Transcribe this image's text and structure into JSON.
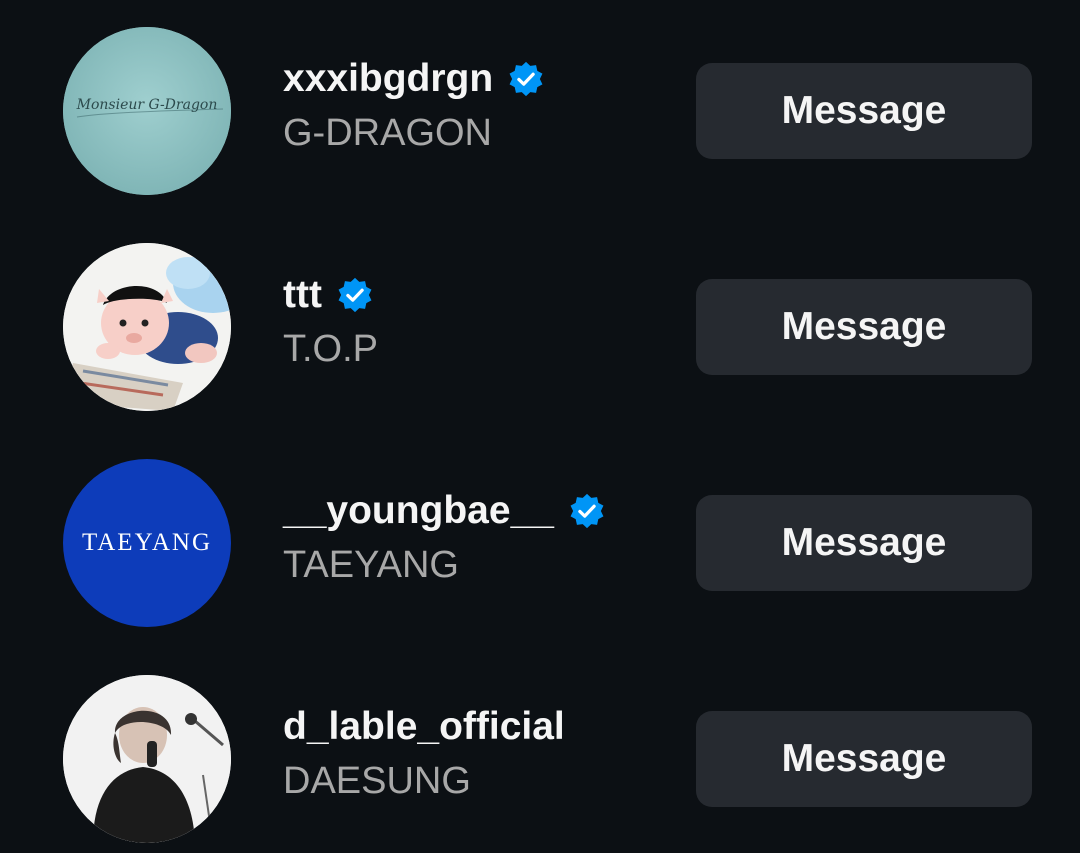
{
  "accounts": [
    {
      "username": "xxxibgdrgn",
      "full_name": "G-DRAGON",
      "verified": true,
      "avatar_text": "Monsieur G-Dragon",
      "button_label": "Message"
    },
    {
      "username": "ttt",
      "full_name": "T.O.P",
      "verified": true,
      "button_label": "Message"
    },
    {
      "username": "__youngbae__",
      "full_name": "TAEYANG",
      "verified": true,
      "avatar_text": "TAEYANG",
      "button_label": "Message"
    },
    {
      "username": "d_lable_official",
      "full_name": "DAESUNG",
      "verified": false,
      "button_label": "Message"
    }
  ],
  "colors": {
    "background": "#0c1014",
    "button": "#262a30",
    "verified_badge": "#0095f6",
    "secondary_text": "#a8a8a8"
  },
  "icons": {
    "verified": "verified-badge-icon"
  }
}
